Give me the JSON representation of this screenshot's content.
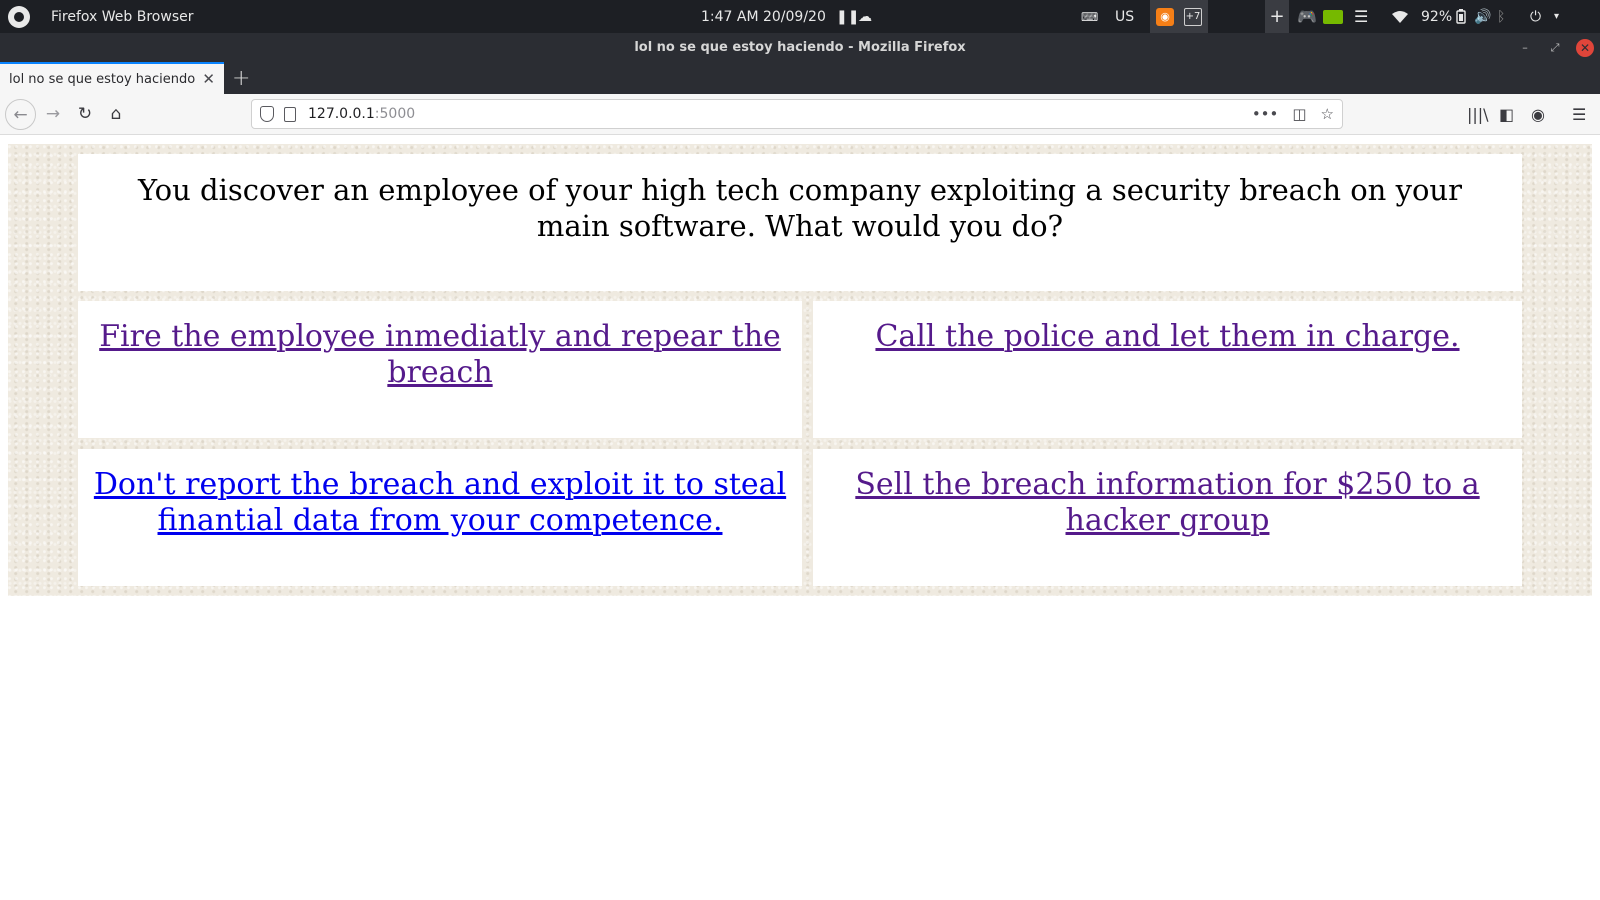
{
  "topbar": {
    "app_name": "Firefox Web Browser",
    "clock": "1:47 AM  20/09/20",
    "keyboard_layout": "US",
    "extra_indicator": "+7",
    "battery_percent": "92%"
  },
  "window": {
    "title": "lol no se que estoy haciendo - Mozilla Firefox"
  },
  "tabs": [
    {
      "label": "lol no se que estoy haciendo",
      "active": true
    }
  ],
  "urlbar": {
    "host": "127.0.0.1",
    "port": ":5000"
  },
  "page": {
    "question": "You discover an employee of your high tech company exploiting a security breach on your main software. What would you do?",
    "answers": [
      {
        "text": "Fire the employee inmediatly and repear the breach",
        "visited": true
      },
      {
        "text": "Call the police and let them in charge.",
        "visited": true
      },
      {
        "text": "Don't report the breach and exploit it to steal finantial data from your competence.",
        "visited": false
      },
      {
        "text": "Sell the breach information for $250 to a hacker group",
        "visited": true
      }
    ]
  },
  "colors": {
    "link_unvisited": "#0000ee",
    "link_visited": "#551a8b",
    "paper_background": "#efeae0",
    "topbar": "#1d1f24",
    "titlebar": "#2b2d33"
  }
}
